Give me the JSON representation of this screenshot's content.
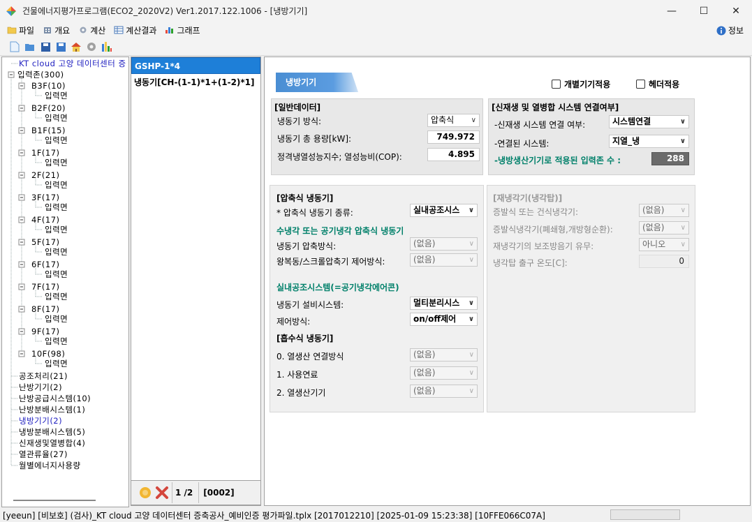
{
  "window": {
    "title": "건물에너지평가프로그램(ECO2_2020V2) Ver1.2017.122.1006 - [냉방기기]",
    "minimize": "—",
    "maximize": "☐",
    "close": "✕"
  },
  "menu": {
    "items": [
      "파일",
      "개요",
      "계산",
      "계산결과",
      "그래프"
    ],
    "info": "정보"
  },
  "tree": {
    "root_truncated": "KT cloud 고양 데이터센터 증",
    "zones": "입력존(300)",
    "floors": [
      {
        "name": "B3F(10)",
        "child": "입력면"
      },
      {
        "name": "B2F(20)",
        "child": "입력면"
      },
      {
        "name": "B1F(15)",
        "child": "입력면"
      },
      {
        "name": "1F(17)",
        "child": "입력면"
      },
      {
        "name": "2F(21)",
        "child": "입력면"
      },
      {
        "name": "3F(17)",
        "child": "입력면"
      },
      {
        "name": "4F(17)",
        "child": "입력면"
      },
      {
        "name": "5F(17)",
        "child": "입력면"
      },
      {
        "name": "6F(17)",
        "child": "입력면"
      },
      {
        "name": "7F(17)",
        "child": "입력면"
      },
      {
        "name": "8F(17)",
        "child": "입력면"
      },
      {
        "name": "9F(17)",
        "child": "입력면"
      },
      {
        "name": "10F(98)",
        "child": "입력면"
      }
    ],
    "others": [
      "공조처리(21)",
      "난방기기(2)",
      "난방공급시스템(10)",
      "난방분배시스템(1)",
      "냉방기기(2)",
      "냉방분배시스템(5)",
      "신재생및열병합(4)",
      "열관류율(27)",
      "월별에너지사용량"
    ]
  },
  "list": {
    "items": [
      "GSHP-1*4",
      "냉동기[CH-(1-1)*1+(1-2)*1]"
    ],
    "page": "1 /2",
    "code": "[0002]"
  },
  "main": {
    "tab": "냉방기기",
    "chk_individual": "개별기기적용",
    "chk_header": "헤더적용",
    "general": {
      "title": "[일반데이터]",
      "method_label": "냉동기 방식:",
      "method_value": "압축식",
      "capacity_label": "냉동기 총 용량[kW]:",
      "capacity_value": "749.972",
      "cop_label": "정격냉열성능지수; 열성능비(COP):",
      "cop_value": "4.895"
    },
    "renew": {
      "title": "[신재생 및 열병합 시스템 연결여부]",
      "link_label": "-신재생 시스템 연결 여부:",
      "link_value": "시스템연결",
      "system_label": "-연결된 시스템:",
      "system_value": "지열_냉",
      "count_label": "-냉방생산기기로 적용된 입력존 수 :",
      "count_value": "288"
    },
    "compress": {
      "title": "[압축식 냉동기]",
      "type_label": "* 압축식 냉동기 종류:",
      "type_value": "실내공조시스",
      "water_header": "수냉각 또는 공기냉각 압축식 냉동기",
      "comp_label": "냉동기 압축방식:",
      "comp_value": "(없음)",
      "ctrl_label": "왕복동/스크롤압축기 제어방식:",
      "ctrl_value": "(없음)",
      "indoor_header": "실내공조시스템(=공기냉각에어콘)",
      "equip_label": "냉동기 설비시스템:",
      "equip_value": "멀티분리시스",
      "control_label": "제어방식:",
      "control_value": "on/off제어"
    },
    "absorb": {
      "title": "[흡수식 냉동기]",
      "heat_label": "0. 열생산 연결방식",
      "heat_value": "(없음)",
      "fuel_label": "1. 사용연료",
      "fuel_value": "(없음)",
      "gen_label": "2. 열생산기기",
      "gen_value": "(없음)"
    },
    "cooler": {
      "title": "[재냉각기(냉각탑)]",
      "evap_label": "증발식 또는 건식냉각기:",
      "evap_value": "(없음)",
      "closed_label": "증발식냉각기(폐쇄형,개방형순환):",
      "closed_value": "(없음)",
      "aux_label": "재냉각기의 보조방음기 유무:",
      "aux_value": "아니오",
      "temp_label": "냉각탑 출구 온도[C]:",
      "temp_value": "0"
    }
  },
  "status": {
    "text": "[yeeun] [비보호] (검사)_KT cloud 고양 데이터센터 증축공사_예비인증 평가파일.tplx [2017012210] [2025-01-09 15:23:38] [10FFE066C07A]"
  }
}
